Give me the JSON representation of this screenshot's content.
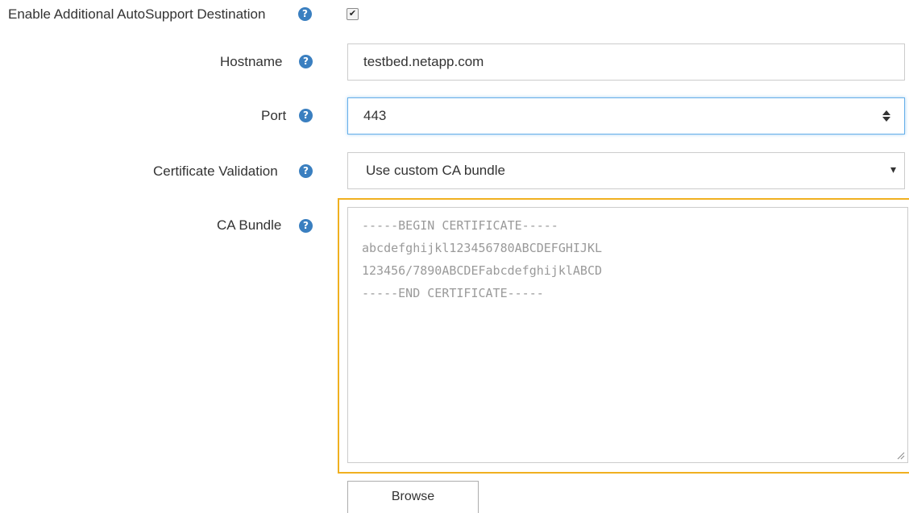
{
  "form": {
    "enable_label": "Enable Additional AutoSupport Destination",
    "enable_checked": true,
    "hostname_label": "Hostname",
    "hostname_value": "testbed.netapp.com",
    "port_label": "Port",
    "port_value": "443",
    "cert_validation_label": "Certificate Validation",
    "cert_validation_value": "Use custom CA bundle",
    "ca_bundle_label": "CA Bundle",
    "ca_bundle_lines": [
      "-----BEGIN CERTIFICATE-----",
      "abcdefghijkl123456780ABCDEFGHIJKL",
      "123456/7890ABCDEFabcdefghijklABCD",
      "-----END CERTIFICATE-----"
    ],
    "browse_label": "Browse"
  },
  "icons": {
    "help": "question-circle-icon",
    "check": "checkmark-icon",
    "spinner": "spinner-arrows-icon",
    "dropdown": "caret-down-icon",
    "resize": "resize-grip-icon"
  },
  "colors": {
    "help_icon": "#3a7fc0",
    "focus_border": "#66afe9",
    "highlight_border": "#f0b020",
    "placeholder_text": "#9a9a9a"
  }
}
